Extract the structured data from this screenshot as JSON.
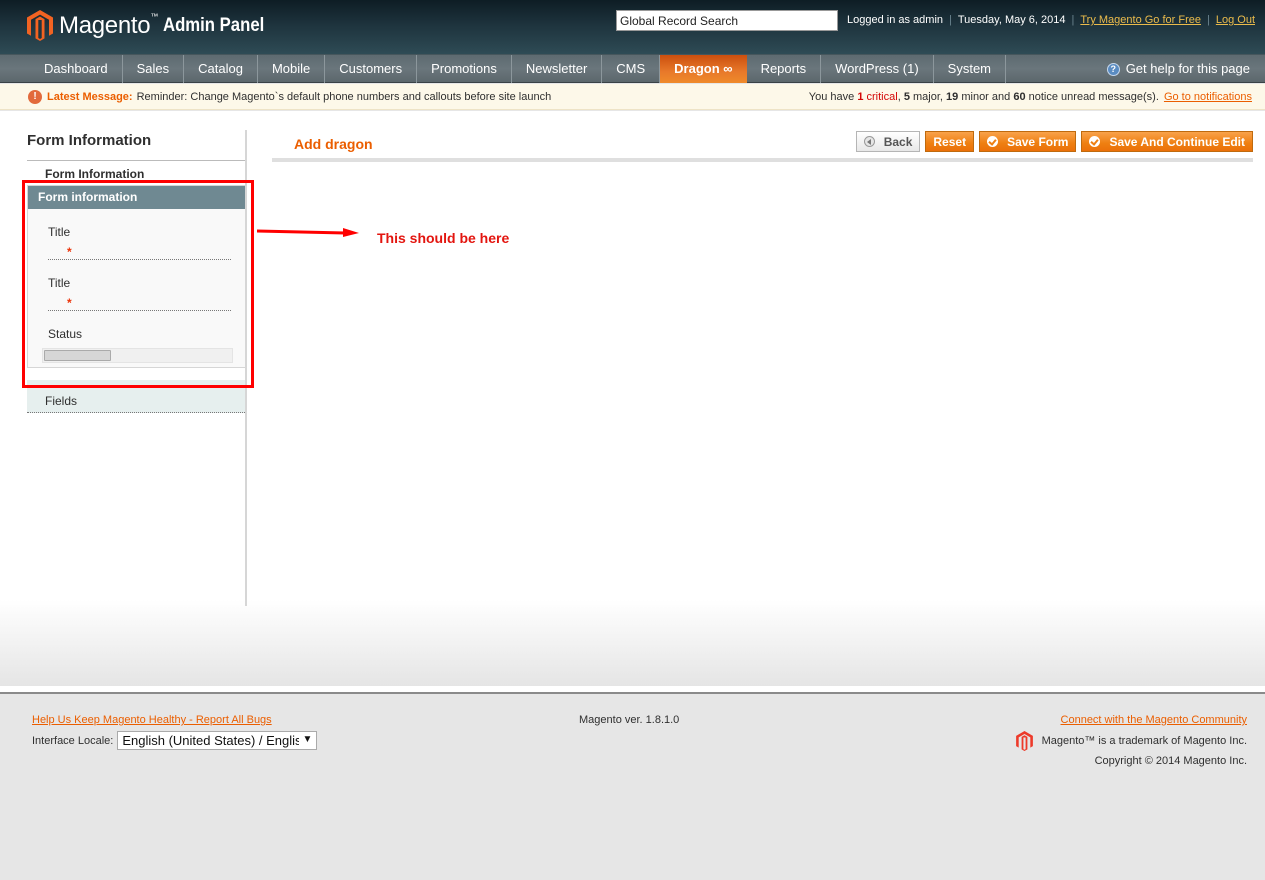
{
  "header": {
    "logo_text": "Magento",
    "logo_tm": "™",
    "logo_sub": "Admin Panel",
    "search_value": "Global Record Search",
    "logged_in": "Logged in as admin",
    "date": "Tuesday, May 6, 2014",
    "try_link": "Try Magento Go for Free",
    "logout_link": "Log Out",
    "separator": "|"
  },
  "nav": {
    "items": [
      {
        "label": "Dashboard"
      },
      {
        "label": "Sales"
      },
      {
        "label": "Catalog"
      },
      {
        "label": "Mobile"
      },
      {
        "label": "Customers"
      },
      {
        "label": "Promotions"
      },
      {
        "label": "Newsletter"
      },
      {
        "label": "CMS"
      },
      {
        "label": "Dragon ∞",
        "active": true
      },
      {
        "label": "Reports"
      },
      {
        "label": "WordPress (1)"
      },
      {
        "label": "System"
      }
    ],
    "help": "Get help for this page",
    "active_color": "#e8792a"
  },
  "message": {
    "label": "Latest Message:",
    "text": "Reminder: Change Magento`s default phone numbers and callouts before site launch",
    "summary_prefix": "You have",
    "critical_count": "1",
    "critical_label": "critical",
    "major": "5",
    "major_label": "major,",
    "minor": "19",
    "minor_label": "minor and",
    "notice": "60",
    "notice_label": "notice unread message(s).",
    "link": "Go to notifications"
  },
  "sidebar": {
    "title": "Form Information",
    "tab_label": "Form Information",
    "fieldset_title": "Form information",
    "fields": [
      {
        "label": "Title",
        "required": "*"
      },
      {
        "label": "Title",
        "required": "*"
      }
    ],
    "status_label": "Status",
    "fields_tab": "Fields"
  },
  "main": {
    "page_title": "Add dragon",
    "buttons": {
      "back": "Back",
      "reset": "Reset",
      "save": "Save Form",
      "save_continue": "Save And Continue Edit"
    },
    "annotation": "This should be here",
    "annotation_color": "#e3150f"
  },
  "footer": {
    "bugs_link": "Help Us Keep Magento Healthy - Report All Bugs",
    "locale_label": "Interface Locale:",
    "locale_value": "English (United States) / English",
    "version": "Magento ver. 1.8.1.0",
    "community_link": "Connect with the Magento Community",
    "trademark": "Magento™ is a trademark of Magento Inc.",
    "copyright": "Copyright © 2014 Magento Inc."
  },
  "colors": {
    "brand_orange": "#eb5e00",
    "header_dark": "#1f353f",
    "fieldset_head": "#6f8992"
  }
}
